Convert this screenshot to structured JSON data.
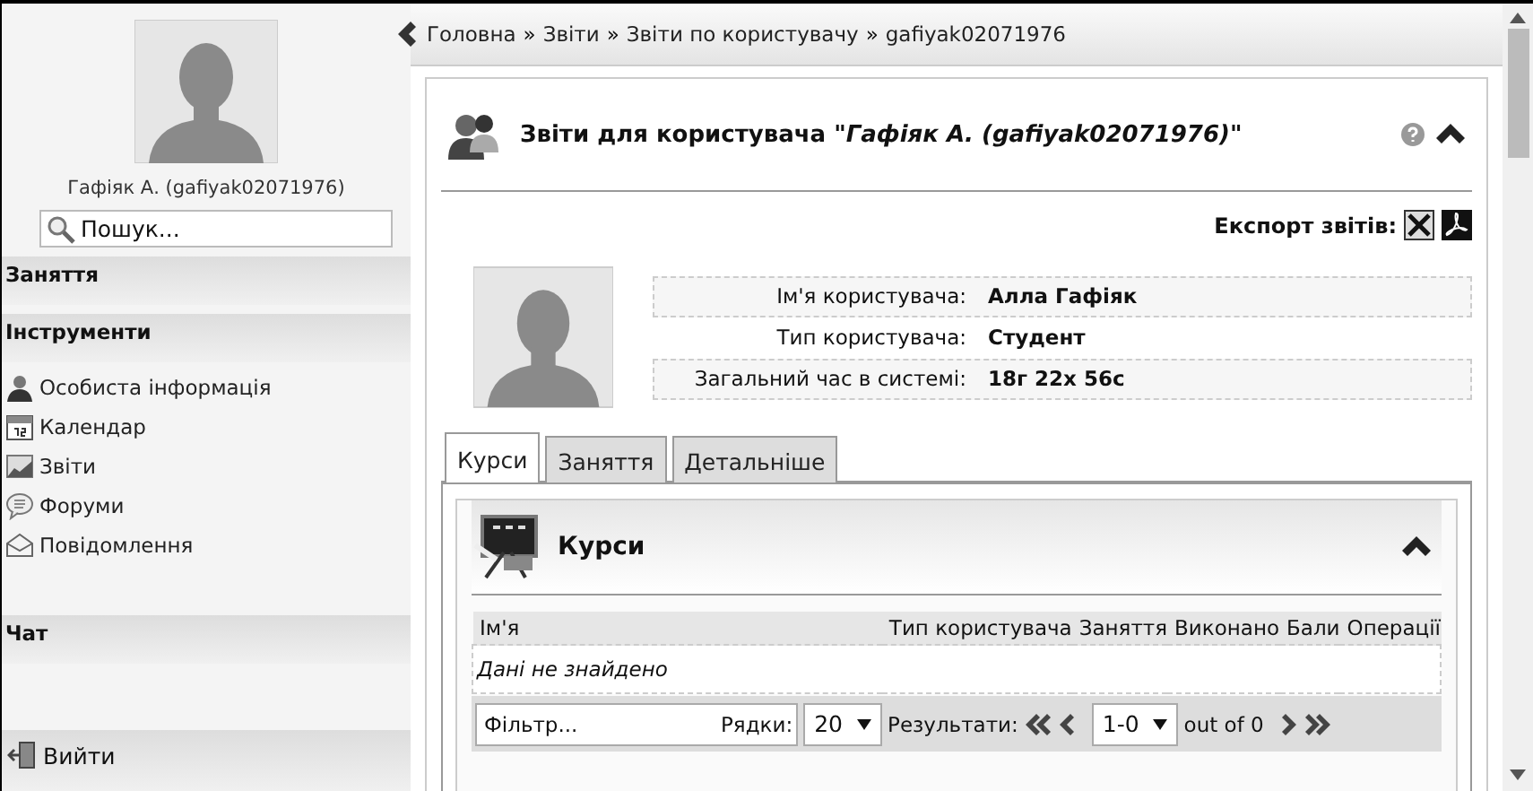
{
  "sidebar": {
    "user_name": "Гафіяк А. (gafiyak02071976)",
    "search": {
      "placeholder": "Пошук..."
    },
    "sections": [
      {
        "title": "Заняття"
      },
      {
        "title": "Інструменти",
        "items": [
          {
            "label": "Особиста інформація",
            "kind": "person"
          },
          {
            "label": "Календар",
            "kind": "calendar"
          },
          {
            "label": "Звіти",
            "kind": "chart"
          },
          {
            "label": "Форуми",
            "kind": "speech"
          },
          {
            "label": "Повідомлення",
            "kind": "envelope"
          }
        ]
      },
      {
        "title": "Чат"
      }
    ],
    "logout": "Вийти"
  },
  "breadcrumb": {
    "items": [
      "Головна",
      "Звіти",
      "Звіти по користувачу",
      "gafiyak02071976"
    ],
    "separator": "»"
  },
  "panel": {
    "title": "Звіти для користувача *\"Гафіяк А. (gafiyak02071976)\"*",
    "export_label": "Експорт звітів:",
    "info": [
      {
        "label": "Ім'я користувача:",
        "value": "Алла Гафіяк"
      },
      {
        "label": "Тип користувача:",
        "value": "Студент"
      },
      {
        "label": "Загальний час в системі:",
        "value": "18г 22х 56с"
      }
    ],
    "tabs": [
      {
        "label": "Курси",
        "selected": true
      },
      {
        "label": "Заняття",
        "selected": false
      },
      {
        "label": "Детальніше",
        "selected": false
      }
    ],
    "courses": {
      "title": "Курси",
      "columns": [
        "Ім'я",
        "Тип користувача",
        "Заняття",
        "Виконано",
        "Бали",
        "Операції"
      ],
      "empty": "Дані не знайдено",
      "pager": {
        "filter_placeholder": "Фільтр...",
        "rows_label": "Рядки:",
        "rows_value": "20",
        "results_label": "Результати:",
        "page_value": "1-0",
        "out_of": "out of 0"
      }
    }
  }
}
